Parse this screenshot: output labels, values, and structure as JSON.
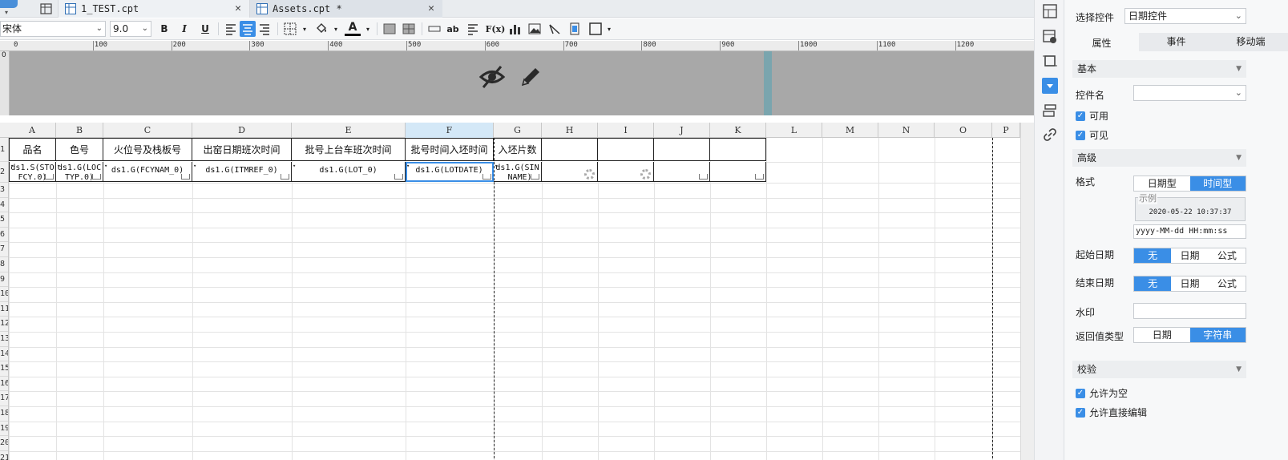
{
  "tabs": [
    {
      "label": "1_TEST.cpt",
      "close": "✕"
    },
    {
      "label": "Assets.cpt *",
      "close": "✕"
    }
  ],
  "toolbar": {
    "font_family": "宋体",
    "font_size": "9.0",
    "bold": "B",
    "italic": "I",
    "underline": "U",
    "text_color": "A",
    "text_tool": "ab",
    "formula": "F(x)"
  },
  "ruler": {
    "zero": "0",
    "labels": [
      "100",
      "200",
      "300",
      "400",
      "500",
      "600",
      "700",
      "800",
      "900",
      "1000",
      "1100",
      "1200"
    ]
  },
  "columns": [
    "A",
    "B",
    "C",
    "D",
    "E",
    "F",
    "G",
    "H",
    "I",
    "J",
    "K",
    "L",
    "M",
    "N",
    "O",
    "P"
  ],
  "rows": [
    "1",
    "2",
    "3",
    "4",
    "5",
    "6",
    "7",
    "8",
    "9",
    "10",
    "11",
    "12",
    "13",
    "14",
    "15",
    "16",
    "17",
    "18",
    "19",
    "20",
    "21"
  ],
  "sheet": {
    "headers": [
      "品名",
      "色号",
      "火位号及栈板号",
      "出窑日期班次时间",
      "批号上台车班次时间",
      "批号时间入坯时间",
      "入坯片数"
    ],
    "cells": [
      "ds1.S(STOFCY.0)",
      "ds1.G(LOCTYP.0)",
      "ds1.G(FCYNAM_0)",
      "ds1.G(ITMREF_0)",
      "ds1.G(LOT_0)",
      "ds1.G(LOTDATE)",
      "ds1.G(SIN_NAME)"
    ]
  },
  "panel": {
    "select_control_label": "选择控件",
    "select_control_value": "日期控件",
    "tabs": [
      "属性",
      "事件",
      "移动端"
    ],
    "basic_section": "基本",
    "control_name_label": "控件名",
    "enabled_label": "可用",
    "visible_label": "可见",
    "advanced_section": "高级",
    "format_label": "格式",
    "format_options": [
      "日期型",
      "时间型"
    ],
    "sample_legend": "示例",
    "sample_value": "2020-05-22 10:37:37",
    "format_pattern": "yyyy-MM-dd HH:mm:ss",
    "start_date_label": "起始日期",
    "end_date_label": "结束日期",
    "date_options": [
      "无",
      "日期",
      "公式"
    ],
    "watermark_label": "水印",
    "return_type_label": "返回值类型",
    "return_type_options": [
      "日期",
      "字符串"
    ],
    "validate_section": "校验",
    "allow_empty_label": "允许为空",
    "allow_edit_label": "允许直接编辑"
  },
  "colors": {
    "accent": "#3a8ee6",
    "header_area": "#a8a8a8",
    "teal_bar": "#7aa5ae"
  }
}
